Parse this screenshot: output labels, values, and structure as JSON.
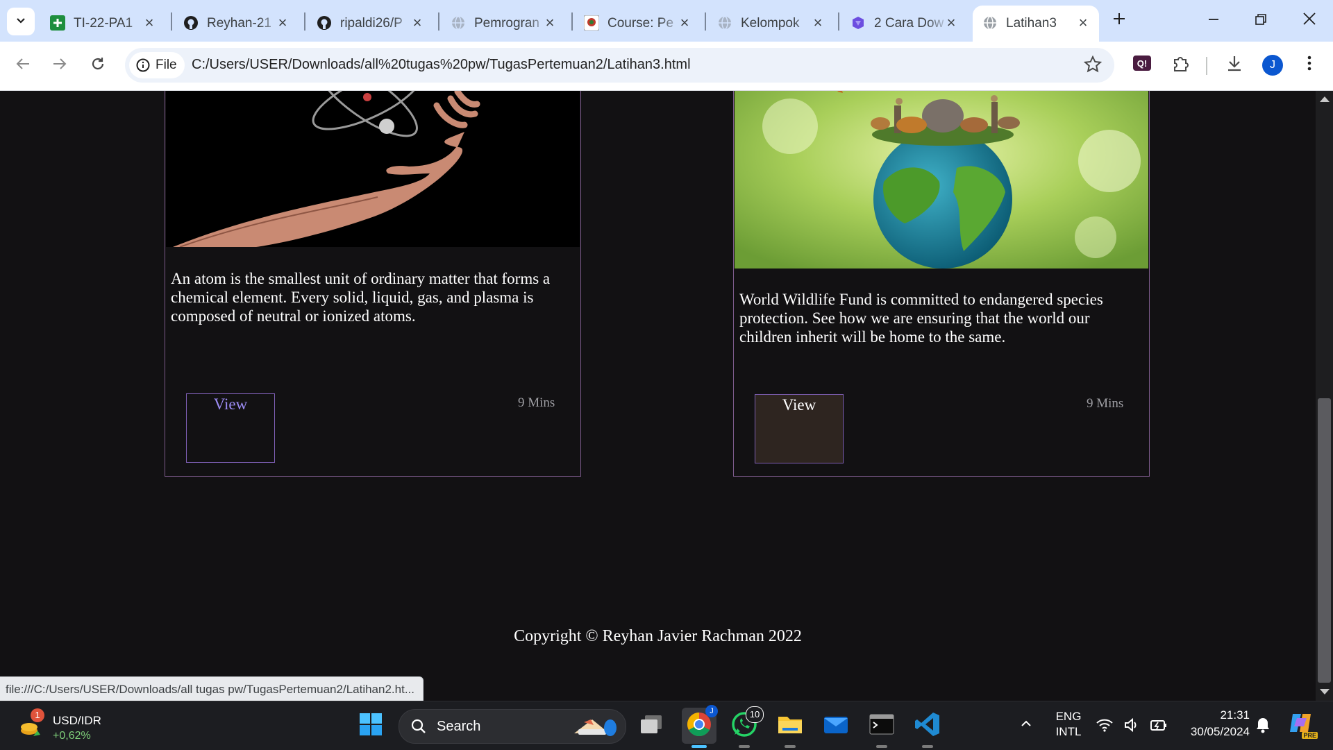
{
  "browser": {
    "tabs": [
      {
        "title": "TI-22-PA1",
        "icon": "sheets-plus-icon",
        "color": "#1e8e3e",
        "active": false
      },
      {
        "title": "Reyhan-21",
        "icon": "github-icon",
        "active": false
      },
      {
        "title": "ripaldi26/P",
        "icon": "github-icon",
        "active": false
      },
      {
        "title": "Pemrogran",
        "icon": "globe-icon",
        "active": false
      },
      {
        "title": "Course: Pe",
        "icon": "course-logo-icon",
        "active": false
      },
      {
        "title": "Kelompok",
        "icon": "globe-icon",
        "active": false
      },
      {
        "title": "2 Cara Dow",
        "icon": "purple-logo-icon",
        "active": false
      },
      {
        "title": "Latihan3",
        "icon": "globe-icon",
        "active": true
      }
    ],
    "site_chip_label": "File",
    "url": "C:/Users/USER/Downloads/all%20tugas%20pw/TugasPertemuan2/Latihan3.html",
    "profile_initial": "J",
    "accent": "#0b57d0"
  },
  "page": {
    "cards": [
      {
        "image_alt": "hand holding atom model",
        "text": "An atom is the smallest unit of ordinary matter that forms a chemical element. Every solid, liquid, gas, and plasma is composed of neutral or ionized atoms.",
        "button_label": "View",
        "duration": "9 Mins"
      },
      {
        "image_alt": "wild animals standing on earth globe",
        "text": "World Wildlife Fund is committed to endangered species protection. See how we are ensuring that the world our children inherit will be home to the same.",
        "button_label": "View",
        "duration": "9 Mins"
      }
    ],
    "footer": "Copyright © Reyhan Javier Rachman 2022",
    "status_link": "file:///C:/Users/USER/Downloads/all tugas pw/TugasPertemuan2/Latihan2.ht..."
  },
  "taskbar": {
    "widget_badge": "1",
    "widget_title": "USD/IDR",
    "widget_value": "+0,62%",
    "search_placeholder": "Search",
    "whatsapp_badge": "10",
    "chrome_profile_badge": "J",
    "lang_line1": "ENG",
    "lang_line2": "INTL",
    "time": "21:31",
    "date": "30/05/2024",
    "copilot_badge": "PRE"
  }
}
